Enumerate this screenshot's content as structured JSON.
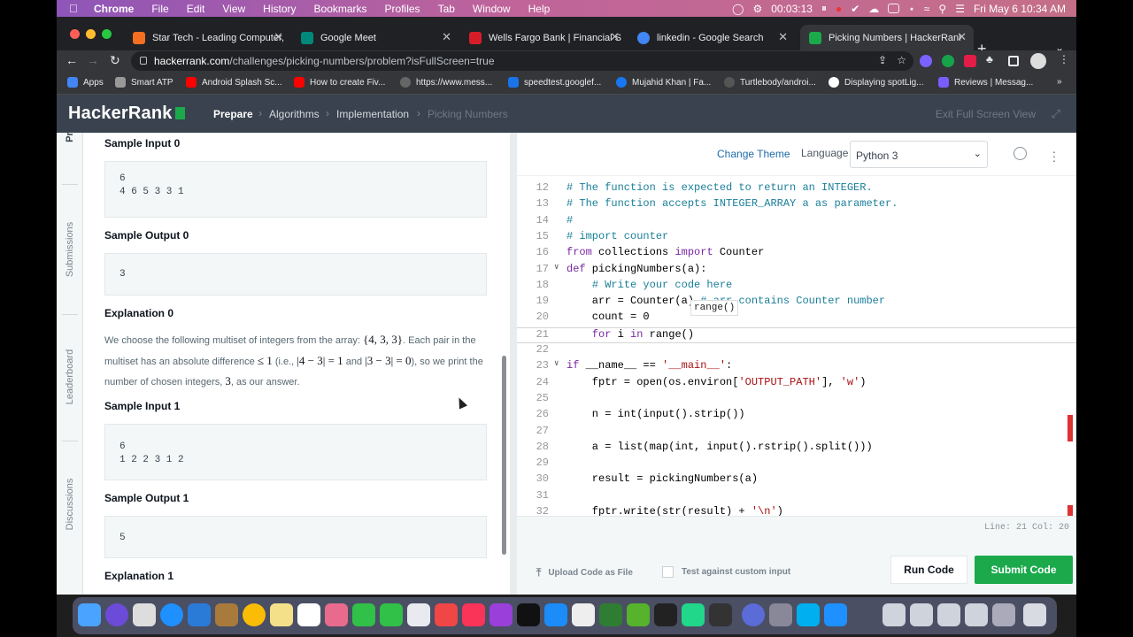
{
  "menubar": {
    "app": "Chrome",
    "items": [
      "File",
      "Edit",
      "View",
      "History",
      "Bookmarks",
      "Profiles",
      "Tab",
      "Window",
      "Help"
    ],
    "timer": "00:03:13",
    "datetime": "Fri May 6  10:34 AM"
  },
  "tabs": [
    {
      "title": "Star Tech - Leading Computer,",
      "icon_color": "#f36f21"
    },
    {
      "title": "Google Meet",
      "icon_color": "#00897b"
    },
    {
      "title": "Wells Fargo Bank | Financial Se",
      "icon_color": "#d71e28"
    },
    {
      "title": "linkedin - Google Search",
      "icon_color": "#4285f4"
    },
    {
      "title": "Picking Numbers | HackerRank",
      "icon_color": "#1ba94c"
    }
  ],
  "address": {
    "domain": "hackerrank.com",
    "path": "/challenges/picking-numbers/problem?isFullScreen=true"
  },
  "bookmarks": [
    "Apps",
    "Smart ATP",
    "Android Splash Sc...",
    "How to create Fiv...",
    "https://www.mess...",
    "speedtest.googlef...",
    "Mujahid Khan | Fa...",
    "Turtlebody/androi...",
    "Displaying spotLig...",
    "Reviews | Messag..."
  ],
  "hr_header": {
    "logo": "HackerRank",
    "crumbs": [
      "Prepare",
      "Algorithms",
      "Implementation",
      "Picking Numbers"
    ],
    "exit": "Exit Full Screen View"
  },
  "side_tabs": [
    "Submissions",
    "Leaderboard",
    "Discussions"
  ],
  "problem": {
    "s_in0_h": "Sample Input 0",
    "s_in0_l1": "6",
    "s_in0_l2": "4 6 5 3 3 1",
    "s_out0_h": "Sample Output 0",
    "s_out0": "3",
    "exp0_h": "Explanation 0",
    "exp0_a": "We choose the following multiset of integers from the array:",
    "exp0_set": "{4, 3, 3}",
    "exp0_b": ". Each pair in the multiset has an absolute difference",
    "exp0_le": "≤ 1",
    "exp0_c": "(i.e.,",
    "exp0_e1": "|4 − 3| = 1",
    "exp0_and": "and",
    "exp0_e2": "|3 − 3| = 0",
    "exp0_d": "), so we print the number of chosen integers,",
    "exp0_n": "3",
    "exp0_e": ", as our answer.",
    "s_in1_h": "Sample Input 1",
    "s_in1_l1": "6",
    "s_in1_l2": "1 2 2 3 1 2",
    "s_out1_h": "Sample Output 1",
    "s_out1": "5",
    "exp1_h": "Explanation 1"
  },
  "editor": {
    "change_theme": "Change Theme",
    "language_label": "Language",
    "language": "Python 3",
    "tooltip": "range()",
    "status": "Line: 21 Col: 20",
    "lines": [
      {
        "n": "12",
        "t": "# The function is expected to return an INTEGER."
      },
      {
        "n": "13",
        "t": "# The function accepts INTEGER_ARRAY a as parameter."
      },
      {
        "n": "14",
        "t": "#"
      },
      {
        "n": "15",
        "t": "# import counter"
      },
      {
        "n": "16",
        "t": "from collections import Counter"
      },
      {
        "n": "17",
        "t": "def pickingNumbers(a):"
      },
      {
        "n": "18",
        "t": "    # Write your code here"
      },
      {
        "n": "19",
        "t": "    arr = Counter(a) # arr contains Counter number"
      },
      {
        "n": "20",
        "t": "    count = 0"
      },
      {
        "n": "21",
        "t": "    for i in range()"
      },
      {
        "n": "22",
        "t": ""
      },
      {
        "n": "23",
        "t": "if __name__ == '__main__':"
      },
      {
        "n": "24",
        "t": "    fptr = open(os.environ['OUTPUT_PATH'], 'w')"
      },
      {
        "n": "25",
        "t": ""
      },
      {
        "n": "26",
        "t": "    n = int(input().strip())"
      },
      {
        "n": "27",
        "t": ""
      },
      {
        "n": "28",
        "t": "    a = list(map(int, input().rstrip().split()))"
      },
      {
        "n": "29",
        "t": ""
      },
      {
        "n": "30",
        "t": "    result = pickingNumbers(a)"
      },
      {
        "n": "31",
        "t": ""
      },
      {
        "n": "32",
        "t": "    fptr.write(str(result) + '\\n')"
      }
    ]
  },
  "footer": {
    "upload": "Upload Code as File",
    "custom": "Test against custom input",
    "run": "Run Code",
    "submit": "Submit Code"
  }
}
